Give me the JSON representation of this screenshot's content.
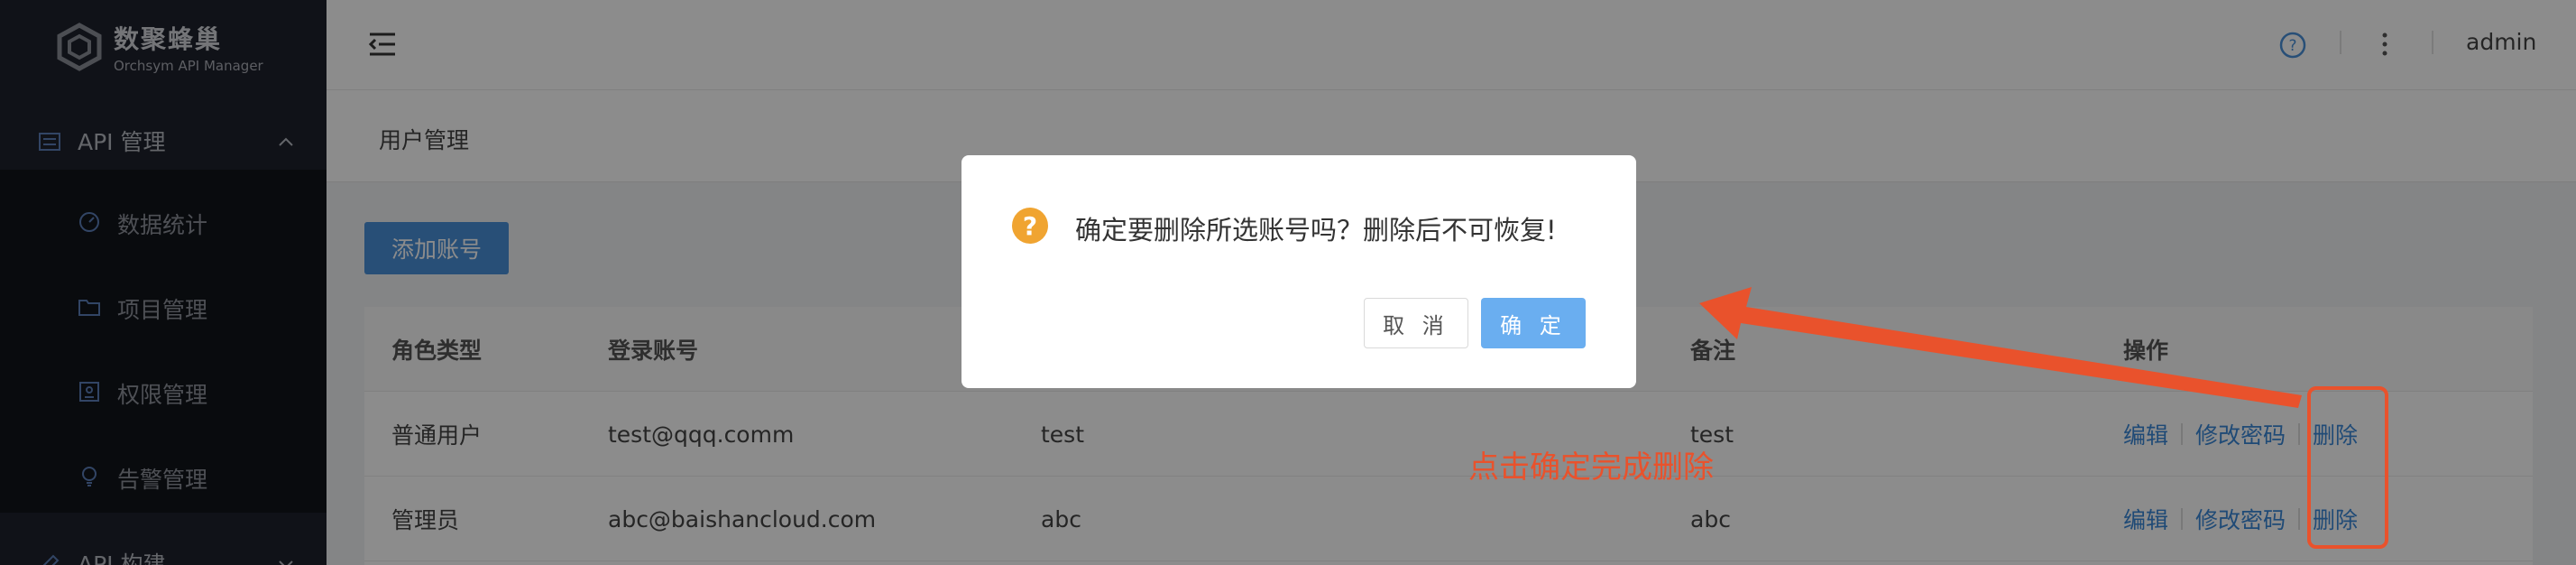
{
  "brand": {
    "name_cn": "数聚蜂巢",
    "name_en": "Orchsym API Manager"
  },
  "sidebar": {
    "groups": [
      {
        "label": "API 管理",
        "expanded": true,
        "icon": "list-icon"
      },
      {
        "label": "API 构建",
        "expanded": false,
        "icon": "edit-icon"
      }
    ],
    "items": [
      {
        "label": "数据统计",
        "icon": "dashboard-icon"
      },
      {
        "label": "项目管理",
        "icon": "folder-icon"
      },
      {
        "label": "权限管理",
        "icon": "id-card-icon"
      },
      {
        "label": "告警管理",
        "icon": "bulb-icon"
      }
    ]
  },
  "topbar": {
    "username": "admin"
  },
  "page": {
    "title": "用户管理",
    "add_button": "添加账号"
  },
  "table": {
    "headers": [
      "角色类型",
      "登录账号",
      "",
      "备注",
      "操作"
    ],
    "rows": [
      {
        "role": "普通用户",
        "account": "test@qqq.comm",
        "name": "test",
        "remark": "test"
      },
      {
        "role": "管理员",
        "account": "abc@baishancloud.com",
        "name": "abc",
        "remark": "abc"
      }
    ],
    "actions": {
      "edit": "编辑",
      "change_password": "修改密码",
      "delete": "删除"
    }
  },
  "dialog": {
    "icon": "?",
    "message": "确定要删除所选账号吗？删除后不可恢复!",
    "cancel": "取 消",
    "ok": "确 定"
  },
  "annotation": {
    "text": "点击确定完成删除",
    "color": "#e9522c"
  },
  "colors": {
    "sidebar_bg": "#1e222d",
    "primary": "#4a90d9",
    "warning": "#f0a431"
  }
}
